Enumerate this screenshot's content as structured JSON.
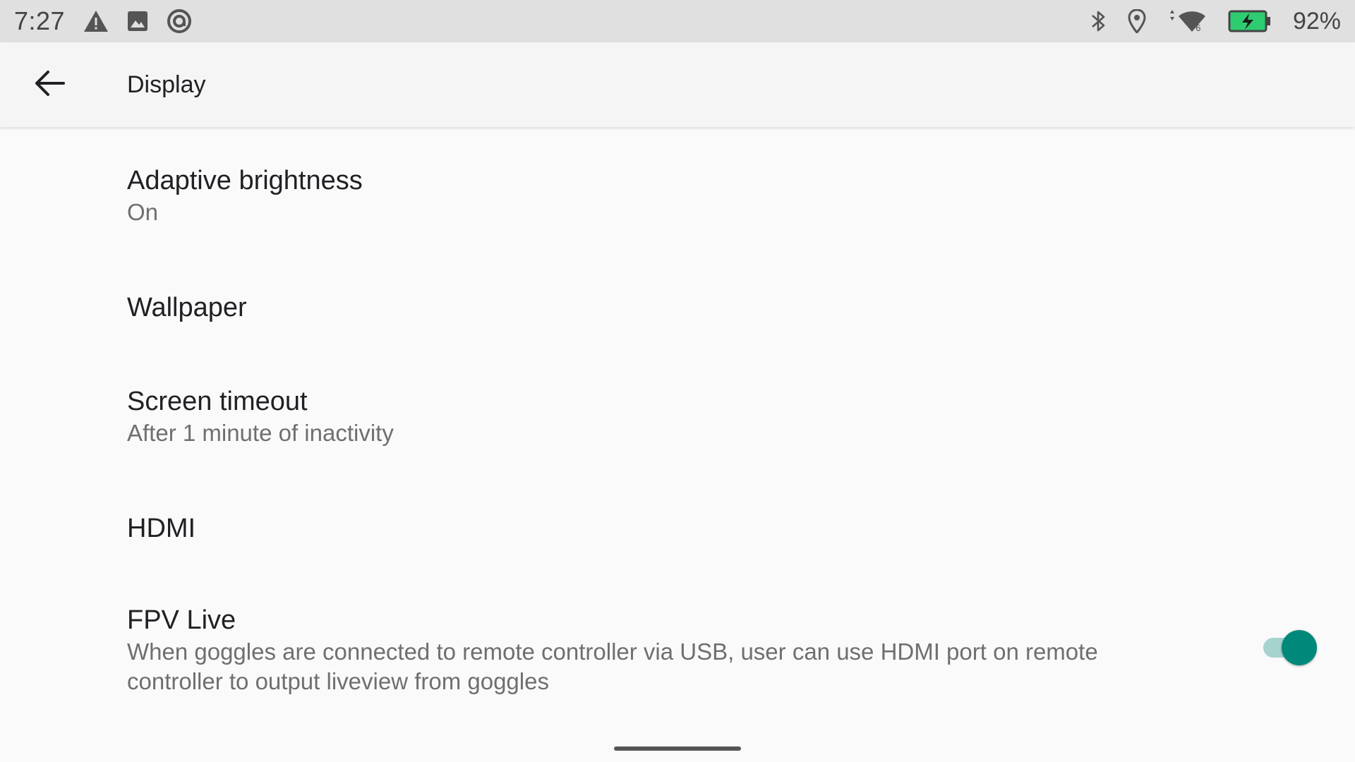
{
  "status_bar": {
    "time": "7:27",
    "left_icons": [
      "warning-icon",
      "image-icon",
      "data-saver-icon"
    ],
    "right_icons": [
      "bluetooth-icon",
      "location-icon",
      "wifi-icon",
      "battery-charging-icon"
    ],
    "battery_percent": "92%",
    "colors": {
      "background": "#e0e0e0",
      "battery_fill": "#2ecc71"
    }
  },
  "app_bar": {
    "back_icon": "arrow-back-icon",
    "title": "Display"
  },
  "settings": [
    {
      "title": "Adaptive brightness",
      "summary": "On"
    },
    {
      "title": "Wallpaper",
      "summary": ""
    },
    {
      "title": "Screen timeout",
      "summary": "After 1 minute of inactivity"
    },
    {
      "title": "HDMI",
      "summary": ""
    },
    {
      "title": "FPV Live",
      "summary": "When goggles are connected to remote controller via USB, user can use HDMI port on remote controller to output liveview from goggles",
      "toggle": {
        "on": true,
        "accent": "#00897b"
      }
    }
  ]
}
